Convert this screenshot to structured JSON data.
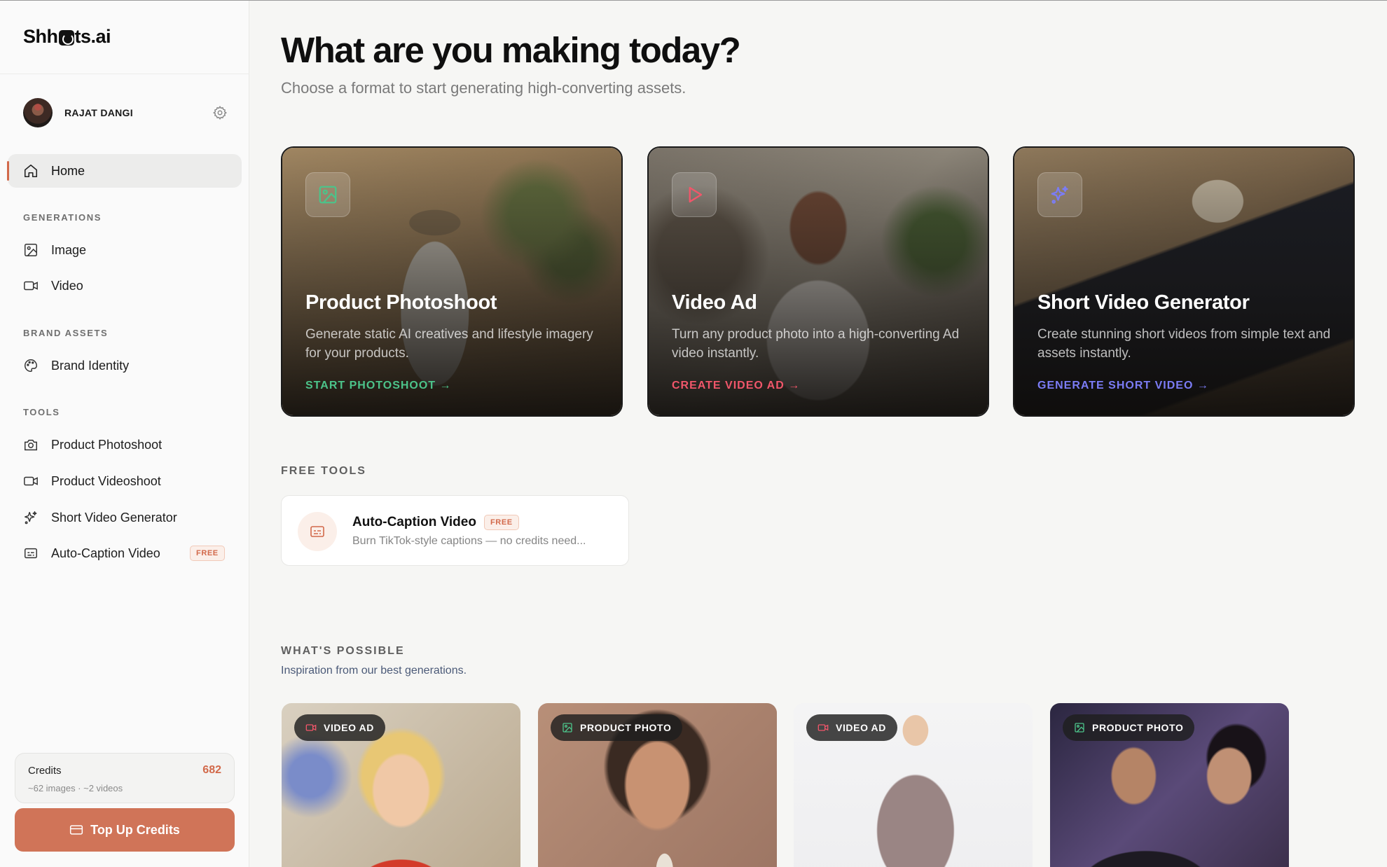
{
  "app": {
    "logo_text": "Shhots.ai",
    "logo_pre": "Shh",
    "logo_post": "ts.ai"
  },
  "user": {
    "name": "RAJAT DANGI"
  },
  "sidebar": {
    "home_label": "Home",
    "sections": [
      {
        "label": "GENERATIONS",
        "items": [
          {
            "label": "Image",
            "icon": "image-icon"
          },
          {
            "label": "Video",
            "icon": "video-icon"
          }
        ]
      },
      {
        "label": "BRAND ASSETS",
        "items": [
          {
            "label": "Brand Identity",
            "icon": "palette-icon"
          }
        ]
      },
      {
        "label": "TOOLS",
        "items": [
          {
            "label": "Product Photoshoot",
            "icon": "camera-icon"
          },
          {
            "label": "Product Videoshoot",
            "icon": "video-icon"
          },
          {
            "label": "Short Video Generator",
            "icon": "sparkles-icon"
          },
          {
            "label": "Auto-Caption Video",
            "icon": "caption-icon",
            "badge": "FREE"
          }
        ]
      }
    ],
    "credits": {
      "title": "Credits",
      "value": "682",
      "sub": "~62 images · ~2 videos"
    },
    "topup_label": "Top Up Credits"
  },
  "main": {
    "title": "What are you making today?",
    "subtitle": "Choose a format to start generating high-converting assets.",
    "cards": [
      {
        "title": "Product Photoshoot",
        "desc": "Generate static AI creatives and lifestyle imagery for your products.",
        "cta": "START PHOTOSHOOT →",
        "accent": "#4cc38a",
        "icon": "image-icon"
      },
      {
        "title": "Video Ad",
        "desc": "Turn any product photo into a high-converting Ad video instantly.",
        "cta": "CREATE VIDEO AD →",
        "accent": "#f0566a",
        "icon": "play-icon"
      },
      {
        "title": "Short Video Generator",
        "desc": "Create stunning short videos from simple text and assets instantly.",
        "cta": "GENERATE SHORT VIDEO →",
        "accent": "#7b7cf5",
        "icon": "sparkles-icon"
      }
    ],
    "free_tools_label": "FREE TOOLS",
    "free_tool": {
      "title": "Auto-Caption Video",
      "badge": "FREE",
      "desc": "Burn TikTok-style captions — no credits need..."
    },
    "whats_possible_label": "WHAT'S POSSIBLE",
    "whats_possible_sub": "Inspiration from our best generations.",
    "tiles": [
      {
        "label": "VIDEO AD",
        "icon": "video-icon"
      },
      {
        "label": "PRODUCT PHOTO",
        "icon": "image-icon"
      },
      {
        "label": "VIDEO AD",
        "icon": "video-icon"
      },
      {
        "label": "PRODUCT PHOTO",
        "icon": "image-icon"
      }
    ]
  },
  "colors": {
    "accent": "#d07458",
    "photo_green": "#4cc38a",
    "video_red": "#f0566a",
    "short_purple": "#7b7cf5"
  }
}
